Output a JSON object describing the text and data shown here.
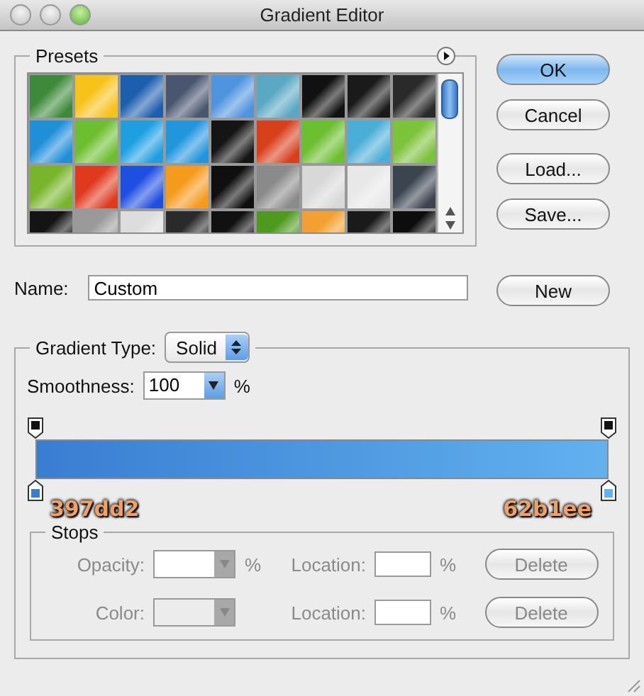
{
  "window": {
    "title": "Gradient Editor"
  },
  "presets": {
    "title": "Presets",
    "swatches": [
      {
        "color": "#3f8a3a"
      },
      {
        "color": "#f7c21a"
      },
      {
        "color": "#1d5fae"
      },
      {
        "color": "#4a5670"
      },
      {
        "color": "#4f94de"
      },
      {
        "color": "#5aa8c4"
      },
      {
        "color": "#111111"
      },
      {
        "color": "#1a1a1a"
      },
      {
        "color": "#2a2a2a"
      },
      {
        "color": "#1f8fd8"
      },
      {
        "color": "#6cbf2e"
      },
      {
        "color": "#1ea0e0"
      },
      {
        "color": "#2196dd"
      },
      {
        "color": "#151515"
      },
      {
        "color": "#d8401c"
      },
      {
        "color": "#6cbf2e"
      },
      {
        "color": "#4aaed8"
      },
      {
        "color": "#7cc23a"
      },
      {
        "color": "#78b52a"
      },
      {
        "color": "#e03a1e"
      },
      {
        "color": "#1f4fe0"
      },
      {
        "color": "#f59a1a"
      },
      {
        "color": "#0f0f0f"
      },
      {
        "color": "#8a8a8a"
      },
      {
        "color": "#d8d8d8"
      },
      {
        "color": "#e8e8e8"
      },
      {
        "color": "#3a4550"
      },
      {
        "color": "#141414"
      },
      {
        "color": "#9a9a9a"
      },
      {
        "color": "#dddddd"
      },
      {
        "color": "#2a2a2a"
      },
      {
        "color": "#111111"
      },
      {
        "color": "#4f9a1e"
      },
      {
        "color": "#f4a030"
      },
      {
        "color": "#1a1a1a"
      },
      {
        "color": "#0d0d0d"
      }
    ]
  },
  "buttons": [
    {
      "label": "OK",
      "default": true
    },
    {
      "label": "Cancel",
      "default": false
    },
    {
      "label": "Load...",
      "default": false
    },
    {
      "label": "Save...",
      "default": false
    }
  ],
  "name": {
    "label": "Name:",
    "value": "Custom"
  },
  "new_button": "New",
  "gradient": {
    "type_label": "Gradient Type:",
    "type_value": "Solid",
    "smoothness_label": "Smoothness:",
    "smoothness_value": "100",
    "percent": "%",
    "stops": [
      {
        "color": "#397dd2",
        "label": "397dd2"
      },
      {
        "color": "#62b1ee",
        "label": "62b1ee"
      }
    ]
  },
  "stops_group": {
    "title": "Stops",
    "rows": [
      {
        "label": "Opacity:",
        "unit": "%",
        "location_label": "Location:",
        "location_unit": "%",
        "button": "Delete",
        "disabled": true
      },
      {
        "label": "Color:",
        "location_label": "Location:",
        "location_unit": "%",
        "button": "Delete",
        "disabled": true
      }
    ]
  }
}
